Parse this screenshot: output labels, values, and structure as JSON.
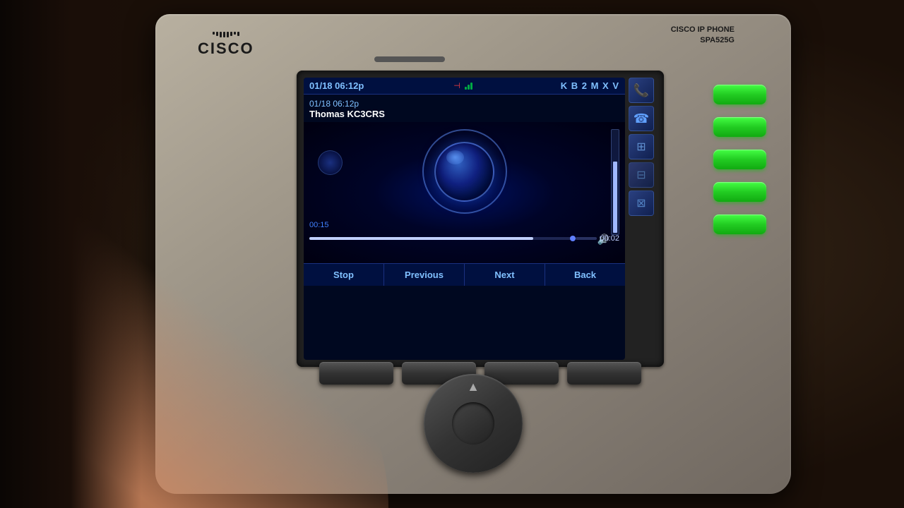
{
  "page": {
    "title": "Cisco IP Phone SPA525G",
    "bg_color": "#1a0f08"
  },
  "phone": {
    "brand": "CISCO",
    "model_line1": "CISCO IP PHONE",
    "model_line2": "SPA525G",
    "logo_bars": 8
  },
  "screen": {
    "status_bar": {
      "datetime": "01/18 06:12p",
      "divider": "—",
      "signal_bars": 3,
      "letters": "K B 2 M X V"
    },
    "call_info": {
      "datetime": "01/18 06:12p",
      "caller_name": "Thomas KC3CRS"
    },
    "playback": {
      "time_elapsed": "00:15",
      "time_remaining": "00:02"
    },
    "softkeys": {
      "stop": "Stop",
      "previous": "Previous",
      "next": "Next",
      "back": "Back"
    }
  },
  "green_buttons": {
    "count": 5
  }
}
